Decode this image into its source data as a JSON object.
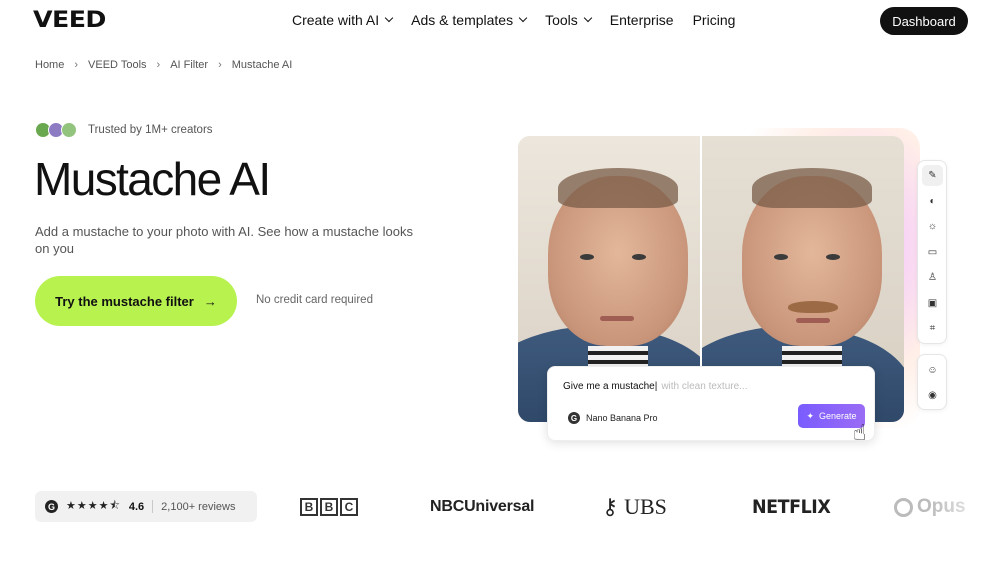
{
  "nav": {
    "logo": "VEED",
    "links": [
      {
        "label": "Create with AI",
        "dropdown": true
      },
      {
        "label": "Ads & templates",
        "dropdown": true
      },
      {
        "label": "Tools",
        "dropdown": true
      },
      {
        "label": "Enterprise",
        "dropdown": false
      },
      {
        "label": "Pricing",
        "dropdown": false
      }
    ],
    "dashboard_label": "Dashboard"
  },
  "breadcrumb": [
    "Home",
    "VEED Tools",
    "AI Filter",
    "Mustache AI"
  ],
  "hero": {
    "trust_text": "Trusted by 1M+ creators",
    "title": "Mustache AI",
    "subtitle": "Add a mustache to your photo with AI. See how a mustache looks on you",
    "cta_label": "Try the mustache filter",
    "no_card": "No credit card required"
  },
  "preview": {
    "prompt_text": "Give me a mustache",
    "prompt_placeholder": "with clean texture...",
    "model_name": "Nano Banana Pro",
    "generate_label": "Generate"
  },
  "social_proof": {
    "rating": "4.6",
    "reviews": "2,100+ reviews",
    "stars_filled": 4.5,
    "brands": [
      "BBC",
      "NBCUniversal",
      "UBS",
      "NETFLIX",
      "Opus"
    ]
  },
  "colors": {
    "cta": "#b7f24f",
    "generate": "#7a5cff",
    "dark": "#111111"
  }
}
